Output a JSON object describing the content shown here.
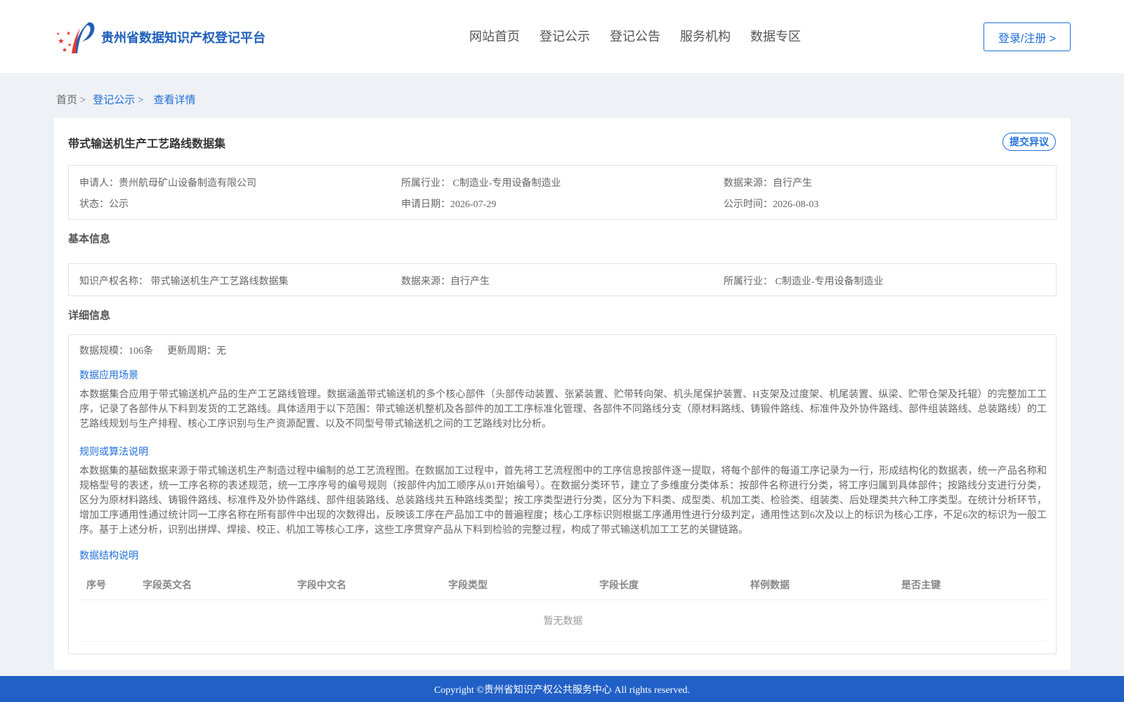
{
  "site": {
    "name": "贵州省数据知识产权登记平台",
    "logo_icon": "red-stars-flag-logo"
  },
  "nav": {
    "items": [
      "网站首页",
      "登记公示",
      "登记公告",
      "服务机构",
      "数据专区"
    ],
    "login": "登录/注册 >"
  },
  "breadcrumb": {
    "home": "首页 >",
    "section": "登记公示 >",
    "current": "查看详情"
  },
  "record": {
    "title": "带式输送机生产工艺路线数据集",
    "objection_button": "提交异议",
    "summary": {
      "applicant": "申请人：贵州航母矿山设备制造有限公司",
      "industry": "所属行业： C制造业-专用设备制造业",
      "source": "数据来源：自行产生",
      "status": "状态：公示",
      "apply_date": "申请日期：2026-07-29",
      "publish_date": "公示时间：2026-08-03"
    },
    "basic": {
      "heading": "基本信息",
      "ip_name": "知识产权名称： 带式输送机生产工艺路线数据集",
      "source": "数据来源：自行产生",
      "industry": "所属行业： C制造业-专用设备制造业"
    },
    "detail": {
      "heading": "详细信息",
      "scale": "数据规模：106条",
      "cycle": "更新周期：无",
      "scenario_title": "数据应用场景",
      "scenario_text": "本数据集合应用于带式输送机产品的生产工艺路线管理。数据涵盖带式输送机的多个核心部件（头部传动装置、张紧装置、贮带转向架、机头尾保护装置、H支架及过度架、机尾装置、纵梁、贮带仓架及托辊）的完整加工工序，记录了各部件从下料到发货的工艺路线。具体适用于以下范围：带式输送机整机及各部件的加工工序标准化管理、各部件不同路线分支（原材料路线、铸锻件路线、标准件及外协件路线、部件组装路线、总装路线）的工艺路线规划与生产排程、核心工序识别与生产资源配置、以及不同型号带式输送机之间的工艺路线对比分析。",
      "rule_title": "规则或算法说明",
      "rule_text": "本数据集的基础数据来源于带式输送机生产制造过程中编制的总工艺流程图。在数据加工过程中，首先将工艺流程图中的工序信息按部件逐一提取，将每个部件的每道工序记录为一行，形成结构化的数据表，统一产品名称和规格型号的表述，统一工序名称的表述规范，统一工序序号的编号规则（按部件内加工顺序从01开始编号）。在数据分类环节，建立了多维度分类体系：按部件名称进行分类，将工序归属到具体部件；按路线分支进行分类，区分为原材料路线、铸锻件路线、标准件及外协件路线、部件组装路线、总装路线共五种路线类型；按工序类型进行分类，区分为下料类、成型类、机加工类、检验类、组装类、后处理类共六种工序类型。在统计分析环节，增加工序通用性通过统计同一工序名称在所有部件中出现的次数得出，反映该工序在产品加工中的普遍程度；核心工序标识则根据工序通用性进行分级判定，通用性达到6次及以上的标识为核心工序，不足6次的标识为一般工序。基于上述分析，识别出拼焊、焊接、校正、机加工等核心工序，这些工序贯穿产品从下料到检验的完整过程，构成了带式输送机加工工艺的关键链路。",
      "structure_title": "数据结构说明",
      "columns": [
        "序号",
        "字段英文名",
        "字段中文名",
        "字段类型",
        "字段长度",
        "样例数据",
        "是否主键"
      ],
      "empty_text": "暂无数据"
    }
  },
  "footer": {
    "copyright": "Copyright ©贵州省知识产权公共服务中心 All rights reserved."
  },
  "colors": {
    "brand_blue": "#1f6fd8",
    "footer_blue": "#2160c6",
    "page_bg": "#eef1f5"
  }
}
